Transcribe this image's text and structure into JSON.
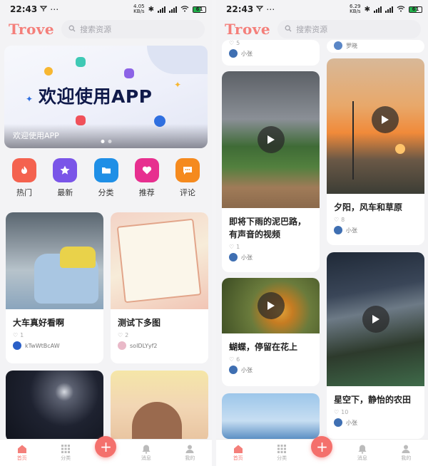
{
  "status": {
    "time": "22:43",
    "net_left": "4.05",
    "net_left_unit": "KB/s",
    "net_right": "6.29",
    "net_right_unit": "KB/s",
    "battery": "61"
  },
  "header": {
    "logo": "Trove",
    "search_placeholder": "搜索资源"
  },
  "banner": {
    "title": "欢迎使用APP",
    "caption": "欢迎使用APP",
    "slide_count": 2,
    "active_slide": 1
  },
  "categories": [
    {
      "label": "热门",
      "icon": "flame-icon",
      "color": "#f4624f"
    },
    {
      "label": "最新",
      "icon": "star-icon",
      "color": "#7a55e8"
    },
    {
      "label": "分类",
      "icon": "folder-icon",
      "color": "#1f8fe6"
    },
    {
      "label": "推荐",
      "icon": "heart-icon",
      "color": "#e72f8f"
    },
    {
      "label": "评论",
      "icon": "comment-icon",
      "color": "#f58a1e"
    }
  ],
  "left_feed": [
    {
      "title": "大车真好看啊",
      "likes": "1",
      "user": "kTwWtBcAW"
    },
    {
      "title": "测试下多图",
      "likes": "2",
      "user": "soIDLYyf2"
    }
  ],
  "right_feed": [
    {
      "title": "",
      "likes": "5",
      "user": "小张"
    },
    {
      "title": "即将下雨的泥巴路，有声音的视频",
      "likes": "1",
      "user": "小张"
    },
    {
      "title": "蝴蝶，停留在花上",
      "likes": "6",
      "user": "小张"
    },
    {
      "title": "",
      "likes": "",
      "user": "罗晓"
    },
    {
      "title": "夕阳，风车和草原",
      "likes": "8",
      "user": "小张"
    },
    {
      "title": "星空下，静怡的农田",
      "likes": "10",
      "user": "小张"
    }
  ],
  "tabbar": {
    "home": "首页",
    "category": "分类",
    "messages": "消息",
    "mine": "我的"
  },
  "colors": {
    "accent": "#f47f7a",
    "fab": "#f4706c"
  }
}
